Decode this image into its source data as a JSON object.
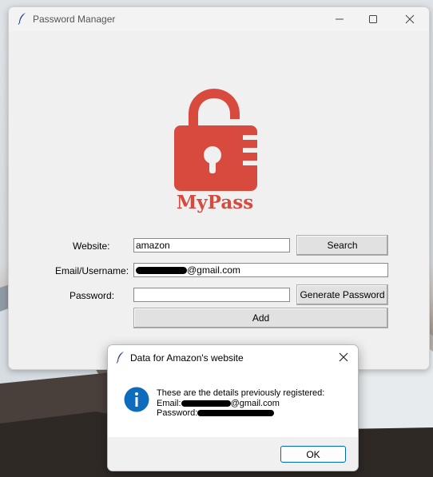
{
  "window": {
    "title": "Password Manager",
    "controls": [
      "minimize",
      "maximize",
      "close"
    ]
  },
  "logo": {
    "text": "MyPass",
    "color": "#d84a3e",
    "icon": "unlocked-padlock-icon"
  },
  "form": {
    "website_label": "Website:",
    "website_value": "amazon",
    "search_label": "Search",
    "email_label": "Email/Username:",
    "email_suffix": "@gmail.com",
    "password_label": "Password:",
    "password_value": "",
    "generate_label": "Generate Password",
    "add_label": "Add"
  },
  "dialog": {
    "title": "Data for Amazon's website",
    "line1": "These are the details previously registered:",
    "email_prefix": "Email:",
    "email_suffix": "@gmail.com",
    "password_prefix": "Password:",
    "ok_label": "OK",
    "icon": "info-icon",
    "accent": "#0067c0"
  }
}
